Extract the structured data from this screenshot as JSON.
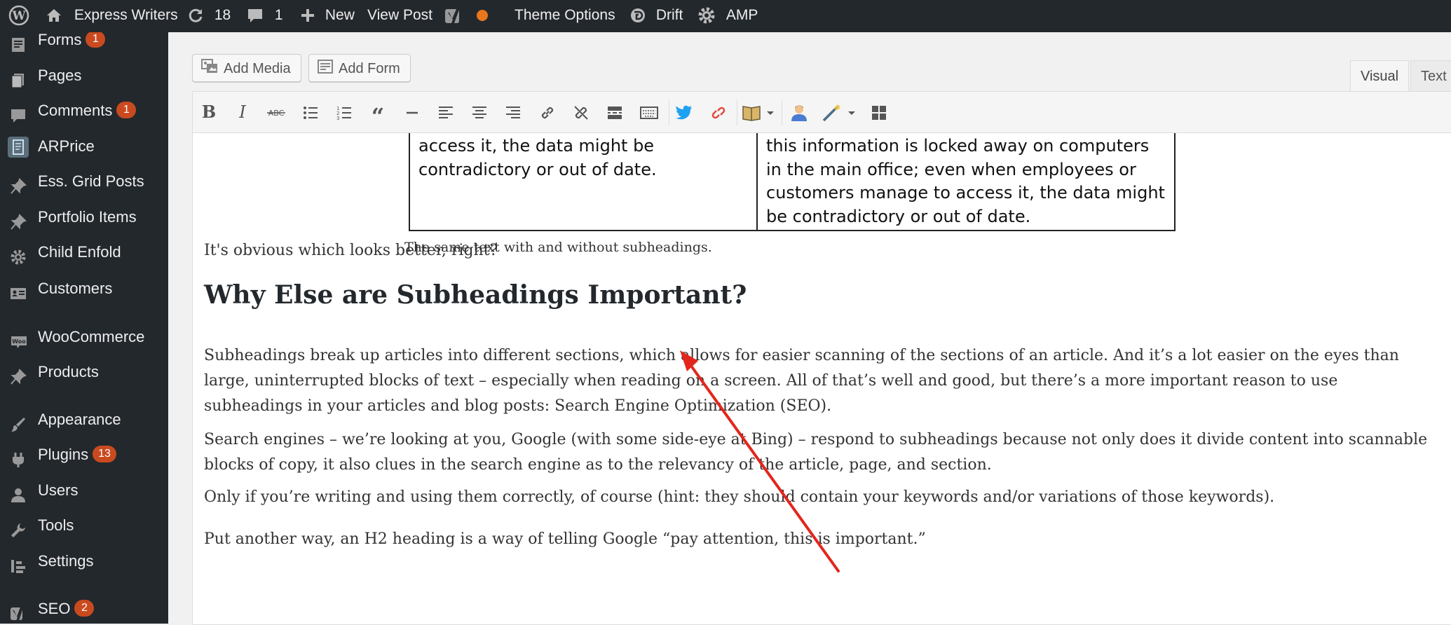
{
  "admin_bar": {
    "site_name": "Express Writers",
    "updates_count": "18",
    "comments_count": "1",
    "new_label": "New",
    "view_post_label": "View Post",
    "theme_options_label": "Theme Options",
    "drift_label": "Drift",
    "amp_label": "AMP",
    "status_dot_color": "#e8771b"
  },
  "sidebar": {
    "items": [
      {
        "label": "Forms",
        "badge": "1",
        "icon": "forms-icon"
      },
      {
        "label": "Pages",
        "badge": "",
        "icon": "pages-icon"
      },
      {
        "label": "Comments",
        "badge": "1",
        "icon": "comments-icon"
      },
      {
        "label": "ARPrice",
        "badge": "",
        "icon": "arprice-icon"
      },
      {
        "label": "Ess. Grid Posts",
        "badge": "",
        "icon": "pin-icon"
      },
      {
        "label": "Portfolio Items",
        "badge": "",
        "icon": "pin-icon"
      },
      {
        "label": "Child Enfold",
        "badge": "",
        "icon": "gear-icon"
      },
      {
        "label": "Customers",
        "badge": "",
        "icon": "customers-icon"
      },
      {
        "label": "WooCommerce",
        "badge": "",
        "icon": "woocommerce-icon"
      },
      {
        "label": "Products",
        "badge": "",
        "icon": "pin-icon"
      },
      {
        "label": "Appearance",
        "badge": "",
        "icon": "brush-icon"
      },
      {
        "label": "Plugins",
        "badge": "13",
        "icon": "plugins-icon"
      },
      {
        "label": "Users",
        "badge": "",
        "icon": "users-icon"
      },
      {
        "label": "Tools",
        "badge": "",
        "icon": "wrench-icon"
      },
      {
        "label": "Settings",
        "badge": "",
        "icon": "settings-icon"
      },
      {
        "label": "SEO",
        "badge": "2",
        "icon": "yoast-icon"
      }
    ],
    "badge_color": "#ca4a1f"
  },
  "editor": {
    "add_media_label": "Add Media",
    "add_form_label": "Add Form",
    "tab_visual": "Visual",
    "tab_text": "Text"
  },
  "content": {
    "table_left_text": "access it, the data might be contradictory or out of date.",
    "table_right_text": "this information is locked away on computers in the main office; even when employees or customers manage to access it, the data might be contradictory or out of date.",
    "caption": "The same text with and without subheadings.",
    "para_obvious": "It's obvious which looks better, right?",
    "heading": "Why Else are Subheadings Important?",
    "para_1": "Subheadings break up articles into different sections, which allows for easier scanning of the sections of an article. And it’s a lot easier on the eyes than large, uninterrupted blocks of text – especially when reading on a screen. All of that’s well and good, but there’s a more important reason to use subheadings in your articles and blog posts: Search Engine Optimization (SEO).",
    "para_2": "Search engines – we’re looking at you, Google (with some side-eye at Bing) – respond to subheadings because not only does it divide content into scannable blocks of copy, it also clues in the search engine as to the relevancy of the article, page, and section.",
    "para_3": "Only if you’re writing and using them correctly, of course (hint: they should contain your keywords and/or variations of those keywords).",
    "para_4": "Put another way, an H2 heading is a way of telling Google “pay attention, this is important.”"
  },
  "annotation": {
    "arrow_color": "#e3261c"
  }
}
